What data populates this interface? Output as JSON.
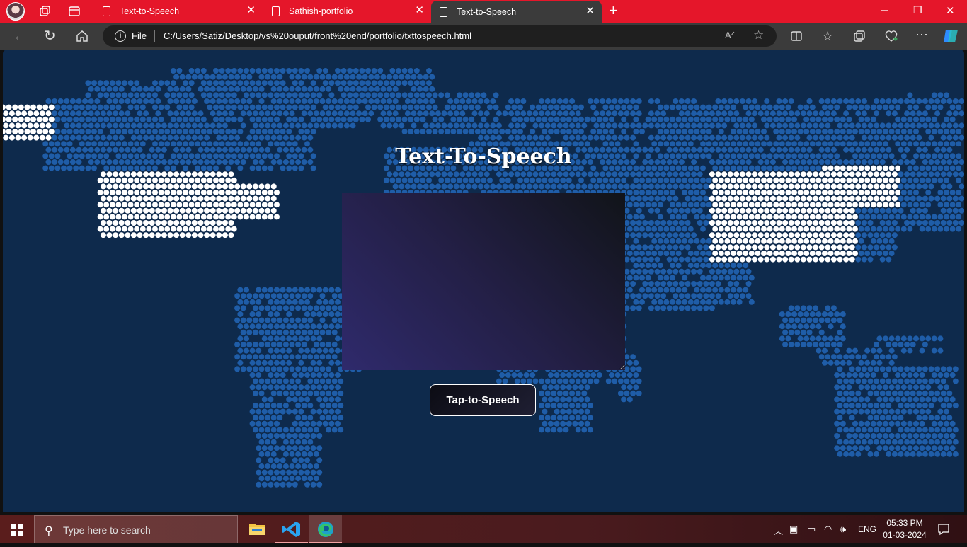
{
  "browser": {
    "tabs": [
      {
        "label": "Text-to-Speech",
        "active": false
      },
      {
        "label": "Sathish-portfolio",
        "active": false
      },
      {
        "label": "Text-to-Speech",
        "active": true
      }
    ],
    "new_tab_icon": "plus-icon",
    "address": {
      "scheme_label": "File",
      "url": "C:/Users/Satiz/Desktop/vs%20ouput/front%20end/portfolio/txttospeech.html"
    },
    "toolbar_icons": [
      "back-icon",
      "refresh-icon",
      "home-icon",
      "read-aloud-icon",
      "favorite-star-icon",
      "split-screen-icon",
      "favorites-icon",
      "collections-icon",
      "browser-essentials-icon",
      "more-icon",
      "copilot-icon"
    ],
    "window_controls": {
      "minimize": "─",
      "restore": "❐",
      "close": "✕"
    }
  },
  "page": {
    "title": "Text-To-Speech",
    "textarea_value": "",
    "button_label": "Tap-to-Speech",
    "colors": {
      "background": "#0e2a4c",
      "map_dot": "#1f5da8",
      "highlight_dot": "#ffffff"
    }
  },
  "taskbar": {
    "search_placeholder": "Type here to search",
    "apps": [
      "file-explorer-icon",
      "vscode-icon",
      "edge-icon"
    ],
    "language": "ENG",
    "time": "05:33 PM",
    "date": "01-03-2024"
  }
}
